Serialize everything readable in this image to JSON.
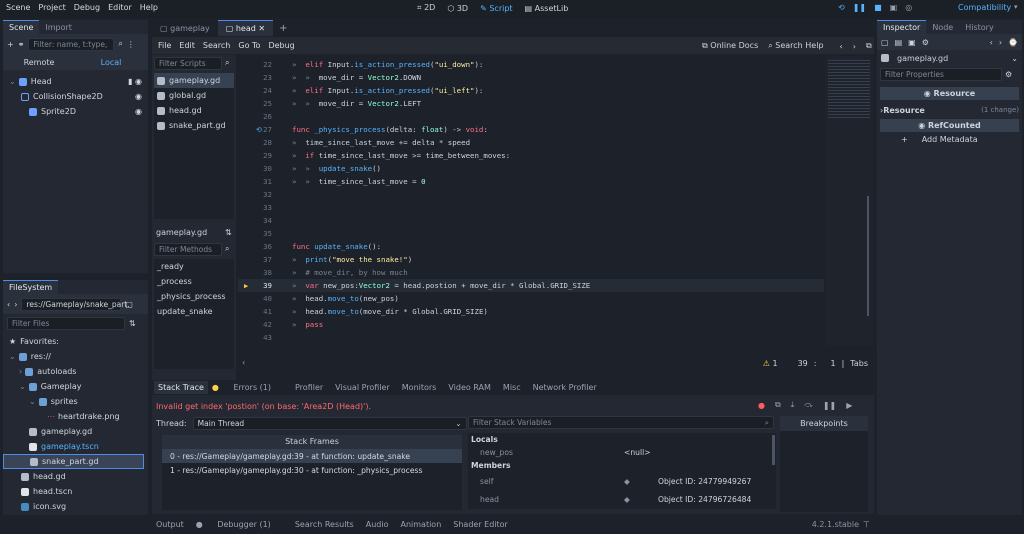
{
  "top_menu": [
    "Scene",
    "Project",
    "Debug",
    "Editor",
    "Help"
  ],
  "workspaces": [
    "2D",
    "3D",
    "Script",
    "AssetLib"
  ],
  "renderer": "Compatibility",
  "scene_dock": {
    "tabs": [
      "Scene",
      "Import"
    ],
    "filter_placeholder": "Filter: name, t:type,",
    "remote": "Remote",
    "local": "Local",
    "nodes": [
      {
        "name": "Head",
        "depth": 0
      },
      {
        "name": "CollisionShape2D",
        "depth": 1
      },
      {
        "name": "Sprite2D",
        "depth": 1
      }
    ]
  },
  "filesystem": {
    "tab": "FileSystem",
    "path": "res://Gameplay/snake_part.",
    "filter_placeholder": "Filter Files",
    "items": [
      {
        "name": "Favorites:",
        "depth": 0
      },
      {
        "name": "res://",
        "depth": 0
      },
      {
        "name": "autoloads",
        "depth": 1
      },
      {
        "name": "Gameplay",
        "depth": 1
      },
      {
        "name": "sprites",
        "depth": 2
      },
      {
        "name": "heartdrake.png",
        "depth": 3
      },
      {
        "name": "gameplay.gd",
        "depth": 2
      },
      {
        "name": "gameplay.tscn",
        "depth": 2
      },
      {
        "name": "snake_part.gd",
        "depth": 2
      },
      {
        "name": "head.gd",
        "depth": 1
      },
      {
        "name": "head.tscn",
        "depth": 1
      },
      {
        "name": "icon.svg",
        "depth": 1
      }
    ]
  },
  "script_tabs": [
    "gameplay",
    "head"
  ],
  "script_menu": [
    "File",
    "Edit",
    "Search",
    "Go To",
    "Debug"
  ],
  "online_docs": "Online Docs",
  "search_help": "Search Help",
  "scripts_filter": "Filter Scripts",
  "scripts": [
    "gameplay.gd",
    "global.gd",
    "head.gd",
    "snake_part.gd"
  ],
  "current_script": "gameplay.gd",
  "methods_filter": "Filter Methods",
  "methods": [
    "_ready",
    "_process",
    "_physics_process",
    "update_snake"
  ],
  "code_lines": [
    {
      "n": "22",
      "t": "\telif Input.is_action_pressed(\"ui_down\"):"
    },
    {
      "n": "23",
      "t": "\t\tmove_dir = Vector2.DOWN"
    },
    {
      "n": "24",
      "t": "\telif Input.is_action_pressed(\"ui_left\"):"
    },
    {
      "n": "25",
      "t": "\t\tmove_dir = Vector2.LEFT"
    },
    {
      "n": "26",
      "t": ""
    },
    {
      "n": "27",
      "t": "func _physics_process(delta: float) -> void:"
    },
    {
      "n": "28",
      "t": "\ttime_since_last_move += delta * speed"
    },
    {
      "n": "29",
      "t": "\tif time_since_last_move >= time_between_moves:"
    },
    {
      "n": "30",
      "t": "\t\tupdate_snake()"
    },
    {
      "n": "31",
      "t": "\t\ttime_since_last_move = 0"
    },
    {
      "n": "32",
      "t": ""
    },
    {
      "n": "33",
      "t": ""
    },
    {
      "n": "34",
      "t": ""
    },
    {
      "n": "35",
      "t": ""
    },
    {
      "n": "36",
      "t": "func update_snake():"
    },
    {
      "n": "37",
      "t": "\tprint(\"move the snake!\")"
    },
    {
      "n": "38",
      "t": "\t# move_dir, by how much"
    },
    {
      "n": "39",
      "t": "\tvar new_pos:Vector2 = head.postion + move_dir * Global.GRID_SIZE"
    },
    {
      "n": "40",
      "t": "\thead.move_to(new_pos)"
    },
    {
      "n": "41",
      "t": "\thead.move_to(move_dir * Global.GRID_SIZE)"
    },
    {
      "n": "42",
      "t": "\tpass"
    },
    {
      "n": "43",
      "t": ""
    }
  ],
  "status": {
    "warnings": "1",
    "line": "39",
    "col": "1",
    "indent": "Tabs"
  },
  "debugger": {
    "tabs": [
      "Stack Trace",
      "Errors (1)",
      "Profiler",
      "Visual Profiler",
      "Monitors",
      "Video RAM",
      "Misc",
      "Network Profiler"
    ],
    "error": "Invalid get index 'postion' (on base: 'Area2D (Head)').",
    "thread_label": "Thread:",
    "thread": "Main Thread",
    "stack_header": "Stack Frames",
    "frames": [
      "0 - res://Gameplay/gameplay.gd:39 - at function: update_snake",
      "1 - res://Gameplay/gameplay.gd:30 - at function: _physics_process"
    ],
    "vars_filter": "Filter Stack Variables",
    "locals": "Locals",
    "members": "Members",
    "vars": [
      {
        "name": "new_pos",
        "value": "<null>"
      },
      {
        "name": "self",
        "value": "Object ID: 24779949267"
      },
      {
        "name": "head",
        "value": "Object ID: 24796726484"
      }
    ],
    "breakpoints": "Breakpoints"
  },
  "bottom_tabs": [
    "Output",
    "Debugger (1)",
    "Search Results",
    "Audio",
    "Animation",
    "Shader Editor"
  ],
  "version": "4.2.1.stable",
  "inspector": {
    "tabs": [
      "Inspector",
      "Node",
      "History"
    ],
    "object": "gameplay.gd",
    "filter": "Filter Properties",
    "resource_head": "Resource",
    "resource": "Resource",
    "changes": "(1 change)",
    "refcounted": "RefCounted",
    "add_metadata": "Add Metadata"
  },
  "colors": {
    "accent": "#4b8ee8",
    "error": "#ff6b6b",
    "script_tab": "#57b3ff"
  }
}
